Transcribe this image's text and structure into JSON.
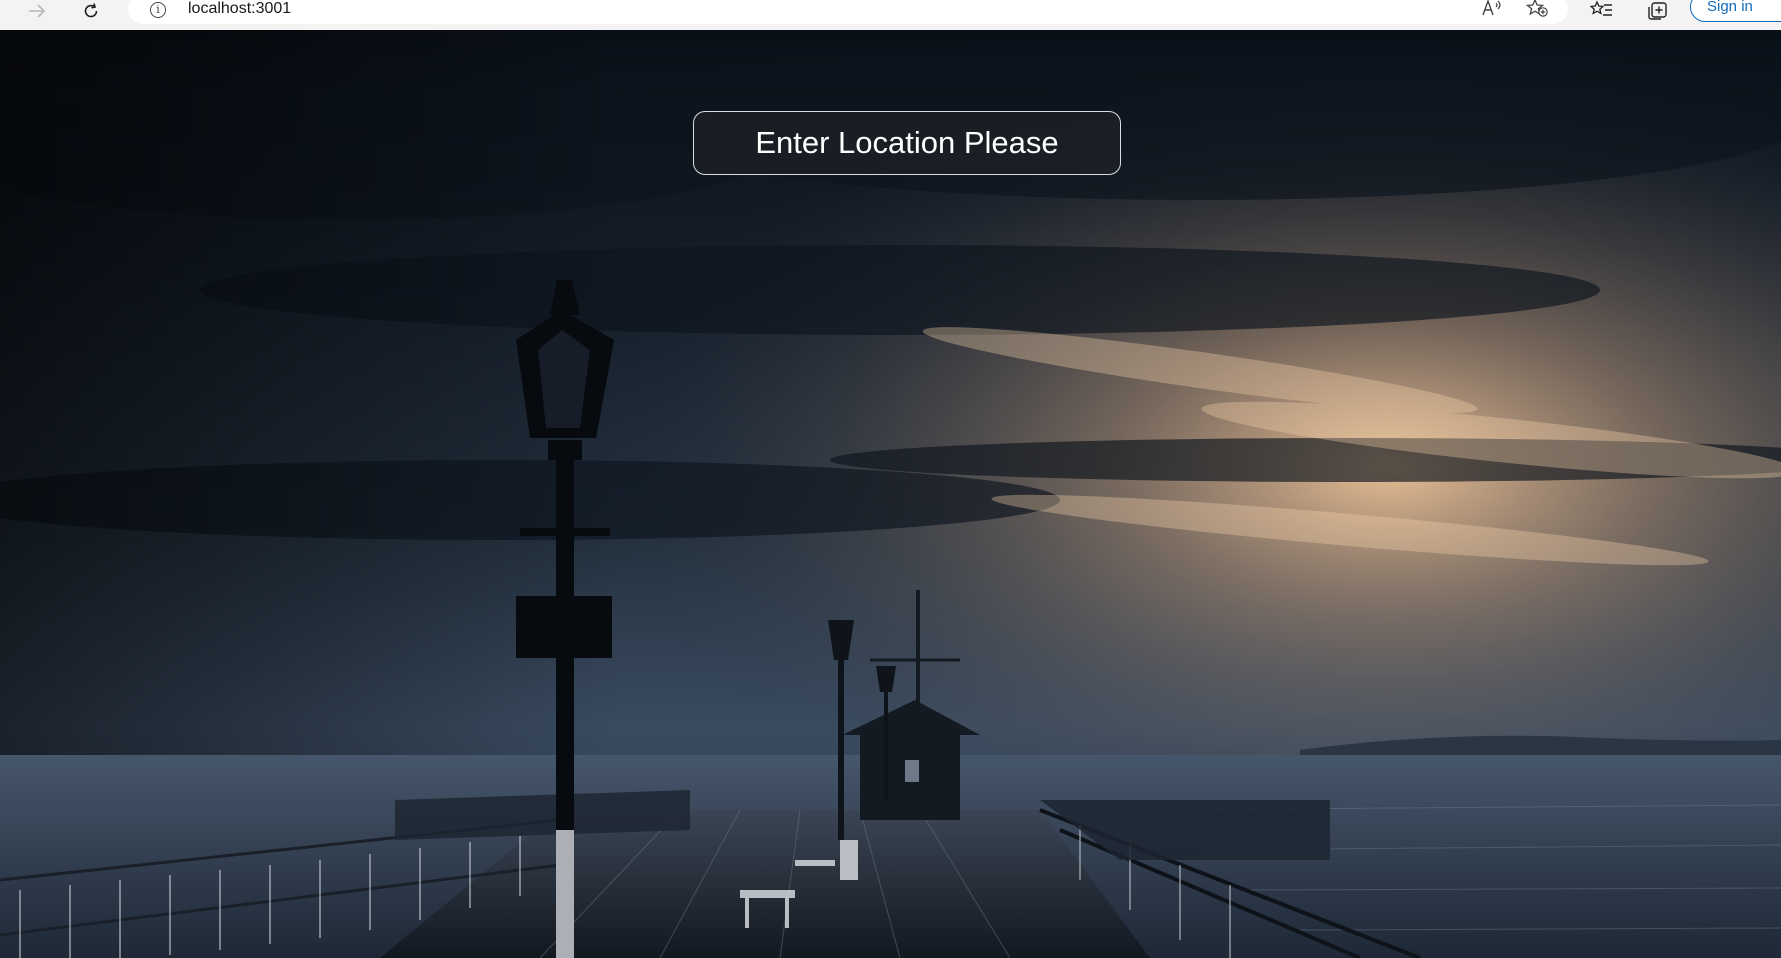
{
  "browser": {
    "url": "localhost:3001",
    "signin_label": "Sign in",
    "icons": {
      "back": "arrow-right-icon",
      "refresh": "refresh-icon",
      "info": "info-icon",
      "read_aloud": "read-aloud-icon",
      "favorite": "add-favorite-icon",
      "favorites": "favorites-icon",
      "collections": "collections-icon"
    }
  },
  "main": {
    "location_button_label": "Enter Location Please",
    "background_description_colors": {
      "sky_dark": "#0b1119",
      "sky_mid": "#2c3a4b",
      "sunset": "#e9b98c",
      "sea": "#3d4d63"
    }
  }
}
